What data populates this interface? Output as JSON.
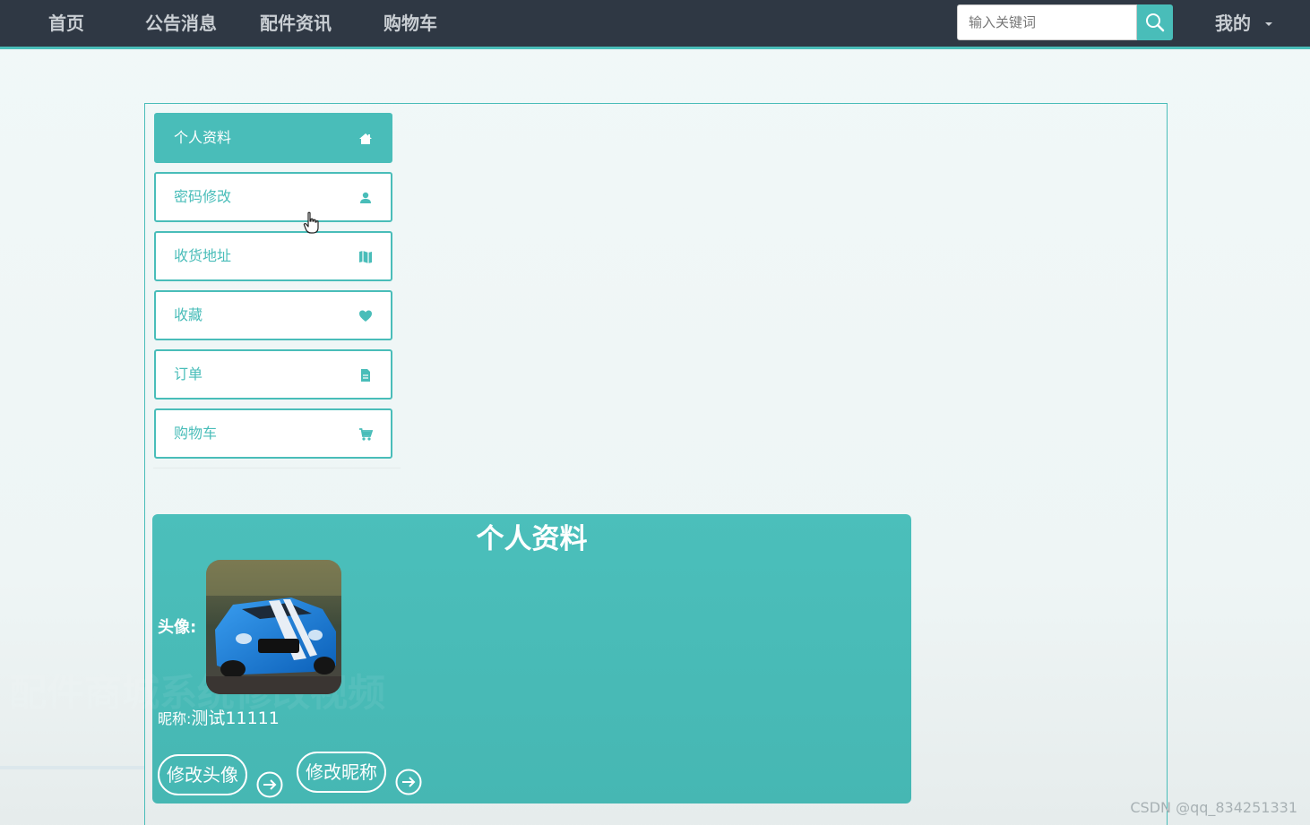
{
  "nav": {
    "items": [
      {
        "label": "首页"
      },
      {
        "label": "公告消息"
      },
      {
        "label": "配件资讯"
      },
      {
        "label": "购物车"
      }
    ],
    "search_placeholder": "输入关键词",
    "mine_label": "我的"
  },
  "sidebar": {
    "items": [
      {
        "label": "个人资料",
        "icon": "home-icon",
        "active": true
      },
      {
        "label": "密码修改",
        "icon": "user-icon",
        "active": false
      },
      {
        "label": "收货地址",
        "icon": "map-icon",
        "active": false
      },
      {
        "label": "收藏",
        "icon": "heart-icon",
        "active": false
      },
      {
        "label": "订单",
        "icon": "file-icon",
        "active": false
      },
      {
        "label": "购物车",
        "icon": "cart-icon",
        "active": false
      }
    ]
  },
  "profile": {
    "title": "个人资料",
    "avatar_label": "头像:",
    "nickname_label": "昵称:",
    "nickname_value": "测试11111",
    "change_avatar_button": "修改头像",
    "change_nickname_button": "修改昵称"
  },
  "overlay": {
    "watermark": "配件商城系统修改视频",
    "credit": "CSDN @qq_834251331"
  },
  "colors": {
    "accent": "#49bdb9",
    "nav_bg": "#2f3844"
  }
}
